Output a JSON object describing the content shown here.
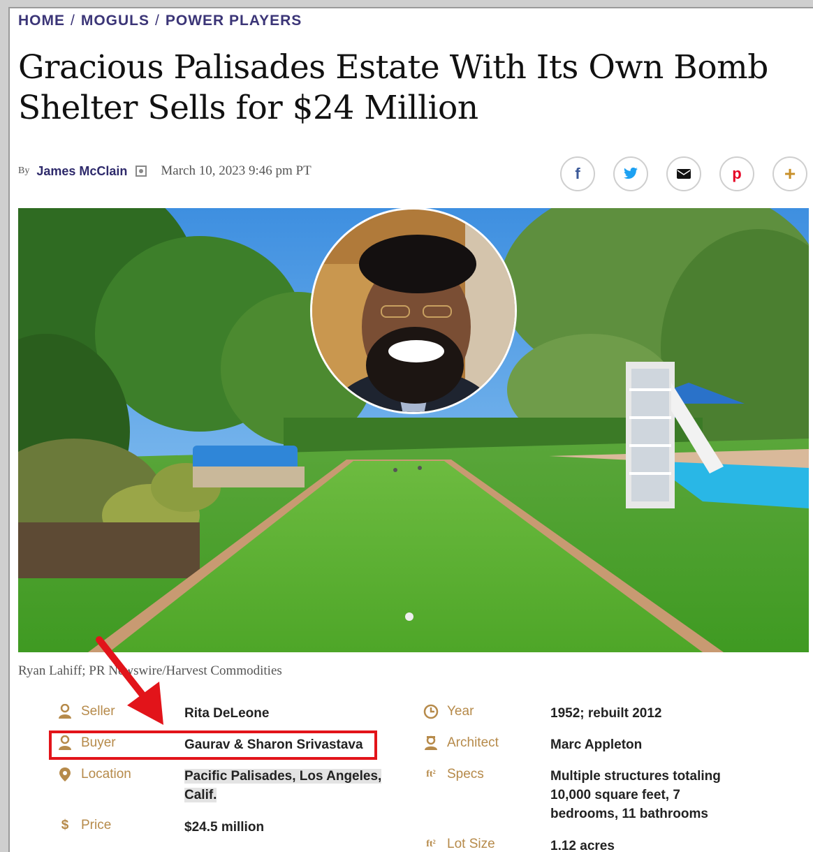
{
  "breadcrumb": [
    "HOME",
    "MOGULS",
    "POWER PLAYERS"
  ],
  "article": {
    "title": "Gracious Palisades Estate With Its Own Bomb Shelter Sells for $24 Million",
    "by_label": "By",
    "author": "James McClain",
    "date": "March 10, 2023 9:46 pm PT",
    "photo_credit": "Ryan Lahiff; PR Newswire/Harvest Commodities"
  },
  "share_buttons": [
    {
      "icon": "facebook-icon",
      "glyph": "f",
      "color": "#3b5998"
    },
    {
      "icon": "twitter-icon",
      "glyph": "t",
      "color": "#1da1f2"
    },
    {
      "icon": "email-icon",
      "glyph": "✉",
      "color": "#111111"
    },
    {
      "icon": "pinterest-icon",
      "glyph": "p",
      "color": "#e60023"
    },
    {
      "icon": "plus-icon",
      "glyph": "+",
      "color": "#c8902a"
    }
  ],
  "facts_left": [
    {
      "label": "Seller",
      "icon": "person-icon",
      "value": "Rita DeLeone"
    },
    {
      "label": "Buyer",
      "icon": "person-icon",
      "value": "Gaurav & Sharon Srivastava"
    },
    {
      "label": "Location",
      "icon": "map-pin-icon",
      "value": "Pacific Palisades, Los Angeles, Calif."
    },
    {
      "label": "Price",
      "icon": "dollar-icon",
      "value": "$24.5 million"
    }
  ],
  "facts_right": [
    {
      "label": "Year",
      "icon": "clock-icon",
      "value": "1952; rebuilt 2012"
    },
    {
      "label": "Architect",
      "icon": "architect-icon",
      "value": "Marc Appleton"
    },
    {
      "label": "Specs",
      "icon": "square-feet-icon",
      "value": "Multiple structures totaling 10,000 square feet, 7 bedrooms, 11 bathrooms"
    },
    {
      "label": "Lot Size",
      "icon": "square-feet-icon",
      "value": "1.12 acres"
    }
  ],
  "colors": {
    "accent": "#b68a4a",
    "nav": "#3b3577",
    "highlight_box": "#e2141a"
  }
}
